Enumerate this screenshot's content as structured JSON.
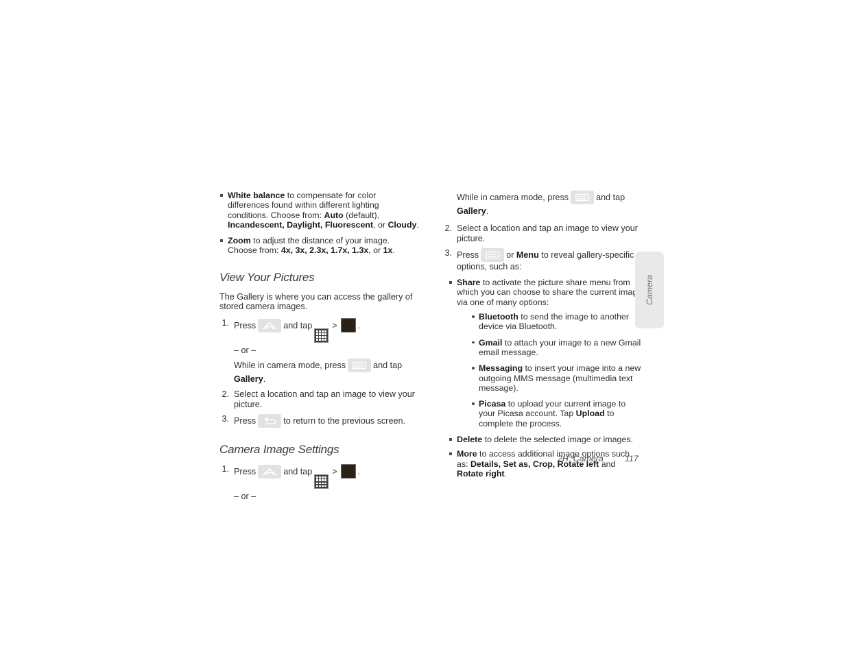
{
  "page": {
    "footer_chapter": "2H. Camera",
    "footer_page_number": "117",
    "side_tab_label": "Camera"
  },
  "icons": {
    "home": "home-key-icon",
    "menu": "menu-key-icon",
    "back": "back-key-icon",
    "launcher": "app-launcher-grid-icon",
    "gallery": "gallery-thumbnail-icon",
    "separator": ">"
  },
  "left_column": {
    "continued_bullets": [
      {
        "term": "White balance",
        "text_a": " to compensate for color differences found within different lighting conditions. Choose from: ",
        "opt1": "Auto",
        "text_b": " (default), ",
        "opt2": "Incandescent, Daylight, Fluorescent",
        "text_c": ", or ",
        "opt3": "Cloudy",
        "text_d": "."
      },
      {
        "term": "Zoom",
        "text_a": " to adjust the distance of your image. Choose from: ",
        "opt1": "4x, 3x, 2.3x, 1.7x, 1.3x",
        "text_b": ", or ",
        "opt2": "1x",
        "text_c": "."
      }
    ],
    "section_view_pictures": {
      "heading": "View Your Pictures",
      "intro": "The Gallery is where you can access the gallery of stored camera images.",
      "steps": [
        {
          "number": "1.",
          "press_label": "Press",
          "and_tap_label": "and tap",
          "trailing": ".",
          "or_label": "– or –",
          "alt_prefix": "While in camera mode, press",
          "alt_mid": "and tap",
          "alt_target": "Gallery",
          "alt_suffix": "."
        },
        {
          "number": "2.",
          "text": "Select a location and tap an image to view your picture."
        },
        {
          "number": "3.",
          "press_label": "Press",
          "after": "to return to the previous screen."
        }
      ]
    },
    "section_image_settings": {
      "heading": "Camera Image Settings",
      "steps": [
        {
          "number": "1.",
          "press_label": "Press",
          "and_tap_label": "and tap",
          "trailing": ".",
          "or_label": "– or –"
        }
      ]
    }
  },
  "right_column": {
    "continued_step": {
      "alt_prefix": "While in camera mode, press",
      "alt_mid": "and tap",
      "alt_target": "Gallery",
      "alt_suffix": "."
    },
    "steps": [
      {
        "number": "2.",
        "text": "Select a location and tap an image to view your picture."
      },
      {
        "number": "3.",
        "press_label": "Press",
        "or_label": "or",
        "menu_label": "Menu",
        "after": "to reveal gallery-specific options, such as:"
      }
    ],
    "options": [
      {
        "term": "Share",
        "text": " to activate the picture share menu from which you can choose to share the current image via one of many options:",
        "sub_options": [
          {
            "term": "Bluetooth",
            "text": " to send the image to another device via Bluetooth."
          },
          {
            "term": "Gmail",
            "text": " to attach your image to a new Gmail email message."
          },
          {
            "term": "Messaging",
            "text": " to insert your image into a new outgoing MMS message (multimedia text message)."
          },
          {
            "term": "Picasa",
            "text_a": " to upload your current image to your Picasa account. Tap ",
            "emphasis": "Upload",
            "text_b": " to complete the process."
          }
        ]
      },
      {
        "term": "Delete",
        "text": " to delete the selected image or images."
      },
      {
        "term": "More",
        "text_a": " to access additional image options such as: ",
        "emphasis_a": "Details, Set as, Crop, Rotate left",
        "text_b": " and ",
        "emphasis_b": "Rotate right",
        "text_c": "."
      }
    ]
  }
}
